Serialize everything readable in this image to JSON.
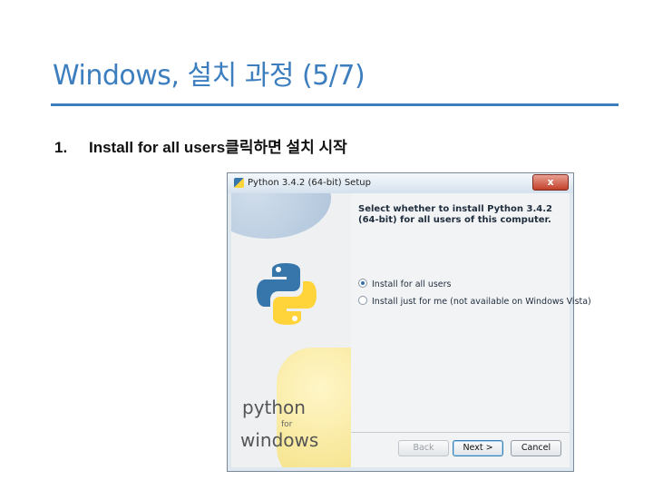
{
  "slide": {
    "title": "Windows, 설치 과정 (5/7)",
    "step_number": "1.",
    "step_text": "Install for all users클릭하면 설치 시작"
  },
  "dialog": {
    "window_title": "Python 3.4.2 (64-bit) Setup",
    "close_label": "x",
    "heading": "Select whether to install Python 3.4.2 (64-bit) for all users of this computer.",
    "options": [
      {
        "label": "Install for all users",
        "selected": true
      },
      {
        "label": "Install just for me (not available on Windows Vista)",
        "selected": false
      }
    ],
    "branding": {
      "python": "python",
      "for": "for",
      "windows": "windows"
    },
    "buttons": {
      "back": "Back",
      "next": "Next >",
      "cancel": "Cancel"
    }
  },
  "colors": {
    "title_blue": "#3d7ebf",
    "python_blue": "#3776ab",
    "python_yellow": "#ffd43b"
  }
}
